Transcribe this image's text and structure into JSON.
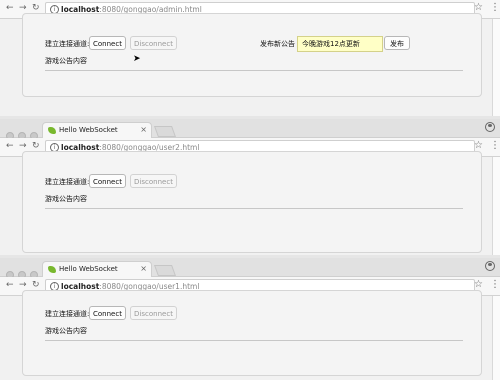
{
  "window_admin": {
    "url_host": "localhost",
    "url_path": ":8080/gonggao/admin.html",
    "connect_label": "建立连接通道:",
    "connect_button": "Connect",
    "disconnect_button": "Disconnect",
    "publish_label": "发布新公告",
    "publish_input_value": "今晚游戏12点更新",
    "publish_button": "发布",
    "announcement_label": "游戏公告内容"
  },
  "window_user2": {
    "tab_title": "Hello WebSocket",
    "url_host": "localhost",
    "url_path": ":8080/gonggao/user2.html",
    "connect_label": "建立连接通道:",
    "connect_button": "Connect",
    "disconnect_button": "Disconnect",
    "announcement_label": "游戏公告内容"
  },
  "window_user1": {
    "tab_title": "Hello WebSocket",
    "url_host": "localhost",
    "url_path": ":8080/gonggao/user1.html",
    "connect_label": "建立连接通道:",
    "connect_button": "Connect",
    "disconnect_button": "Disconnect",
    "announcement_label": "游戏公告内容"
  },
  "browser_icons": [
    "back-arrow-icon",
    "forward-arrow-icon",
    "reload-icon",
    "info-icon",
    "star-icon",
    "menu-icon",
    "profile-icon"
  ],
  "colors": {
    "input_bg": "#ffffc6",
    "favicon": "#79b82e"
  }
}
